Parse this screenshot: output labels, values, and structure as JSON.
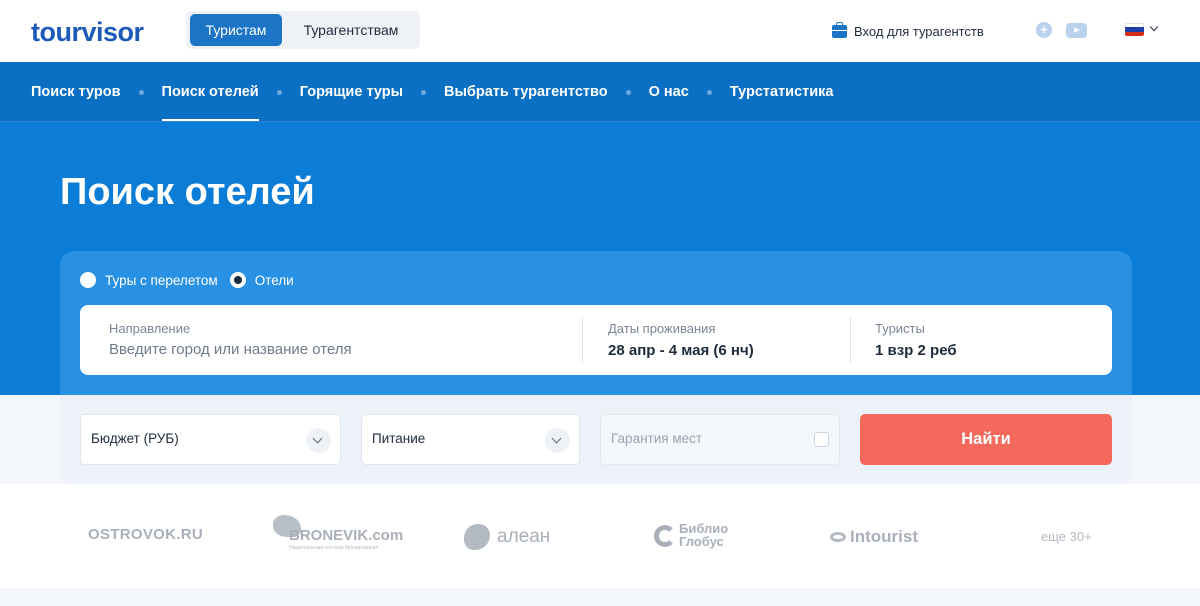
{
  "header": {
    "logo": "tourvisor",
    "switcher": {
      "tourists": "Туристам",
      "agencies": "Турагентствам"
    },
    "agency_login": "Вход для турагентств",
    "icons": {
      "vk": "vk-icon",
      "youtube": "youtube-icon",
      "language": "russia-flag-icon"
    }
  },
  "nav": {
    "items": [
      {
        "label": "Поиск туров"
      },
      {
        "label": "Поиск отелей"
      },
      {
        "label": "Горящие туры"
      },
      {
        "label": "Выбрать турагентство"
      },
      {
        "label": "О нас"
      },
      {
        "label": "Турстатистика"
      }
    ],
    "active": "Поиск отелей"
  },
  "hero": {
    "title": "Поиск отелей"
  },
  "search": {
    "modes": {
      "with_flight": "Туры с перелетом",
      "hotels": "Отели"
    },
    "selected_mode": "hotels",
    "direction": {
      "label": "Направление",
      "placeholder": "Введите город или название отеля",
      "value": ""
    },
    "dates": {
      "label": "Даты проживания",
      "value": "28 апр - 4 мая (6 нч)"
    },
    "tourists": {
      "label": "Туристы",
      "value": "1 взр 2 реб"
    },
    "budget": {
      "label": "Бюджет (РУБ)"
    },
    "food": {
      "label": "Питание"
    },
    "guarantee": {
      "label": "Гарантия мест",
      "checked": false
    },
    "find_button": "Найти"
  },
  "partners": {
    "ostrovok": "OSTROVOK.RU",
    "bronevik": "BRONEVIK.com",
    "bronevik_tagline": "Национальная система бронирования",
    "alean": "алеан",
    "biblio_line1": "Библио",
    "biblio_line2": "Глобус",
    "intourist": "Intourist",
    "more": "еще 30+"
  },
  "colors": {
    "brand_blue": "#0b7dd6",
    "nav_blue": "#0b6fc4",
    "switcher_active": "#1b74c5",
    "find_button": "#f4695c"
  }
}
